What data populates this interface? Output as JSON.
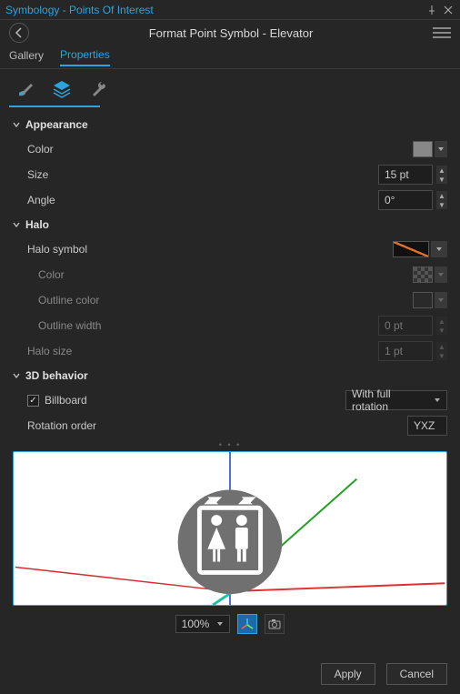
{
  "title": "Symbology - Points Of Interest",
  "header": "Format Point Symbol - Elevator",
  "tabs": {
    "gallery": "Gallery",
    "properties": "Properties"
  },
  "groups": {
    "appearance": {
      "label": "Appearance",
      "color_label": "Color",
      "color_value": "#888888",
      "size_label": "Size",
      "size_value": "15 pt",
      "angle_label": "Angle",
      "angle_value": "0°"
    },
    "halo": {
      "label": "Halo",
      "symbol_label": "Halo symbol",
      "color_label": "Color",
      "outline_color_label": "Outline color",
      "outline_width_label": "Outline width",
      "outline_width_value": "0 pt",
      "size_label": "Halo size",
      "size_value": "1 pt"
    },
    "behavior": {
      "label": "3D behavior",
      "billboard_label": "Billboard",
      "billboard_checked": true,
      "rotation_mode": "With full rotation",
      "rotation_order_label": "Rotation order",
      "rotation_order_value": "YXZ"
    }
  },
  "preview_toolbar": {
    "zoom": "100%"
  },
  "footer": {
    "apply": "Apply",
    "cancel": "Cancel"
  },
  "icons": {
    "pin": "pin-icon",
    "close": "close-icon",
    "back": "back-icon",
    "menu": "menu-icon",
    "brush": "brush-icon",
    "layers": "layers-icon",
    "wrench": "wrench-icon",
    "axes": "axes-toggle-icon",
    "camera": "camera-icon",
    "chevron": "chevron-down-icon"
  }
}
